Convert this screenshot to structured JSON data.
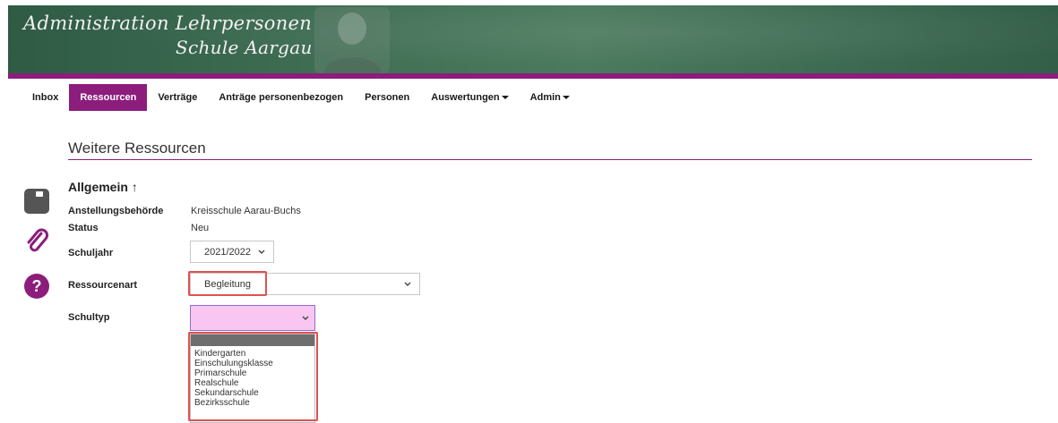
{
  "banner": {
    "title": "Administration Lehrpersonen",
    "subtitle": "Schule Aargau"
  },
  "nav": {
    "items": [
      {
        "label": "Inbox",
        "active": false
      },
      {
        "label": "Ressourcen",
        "active": true
      },
      {
        "label": "Verträge",
        "active": false
      },
      {
        "label": "Anträge personenbezogen",
        "active": false
      },
      {
        "label": "Personen",
        "active": false
      },
      {
        "label": "Auswertungen",
        "active": false,
        "dropdown": true
      },
      {
        "label": "Admin",
        "active": false,
        "dropdown": true
      }
    ]
  },
  "page": {
    "title": "Weitere Ressourcen"
  },
  "side_icons": [
    "save-icon",
    "paperclip-icon",
    "help-icon"
  ],
  "colors": {
    "accent": "#8c1d7c",
    "highlight": "#e05252",
    "open_select_bg": "#f9c6f1"
  },
  "form": {
    "section_title": "Allgemein",
    "section_arrow": "↑",
    "anstellungsbehoerde": {
      "label": "Anstellungsbehörde",
      "value": "Kreisschule Aarau-Buchs"
    },
    "status": {
      "label": "Status",
      "value": "Neu"
    },
    "schuljahr": {
      "label": "Schuljahr",
      "value": "2021/2022"
    },
    "ressourcenart": {
      "label": "Ressourcenart",
      "value": "Begleitung"
    },
    "schultyp": {
      "label": "Schultyp",
      "value": "",
      "options": [
        "Kindergarten",
        "Einschulungsklasse",
        "Primarschule",
        "Realschule",
        "Sekundarschule",
        "Bezirksschule"
      ]
    }
  }
}
